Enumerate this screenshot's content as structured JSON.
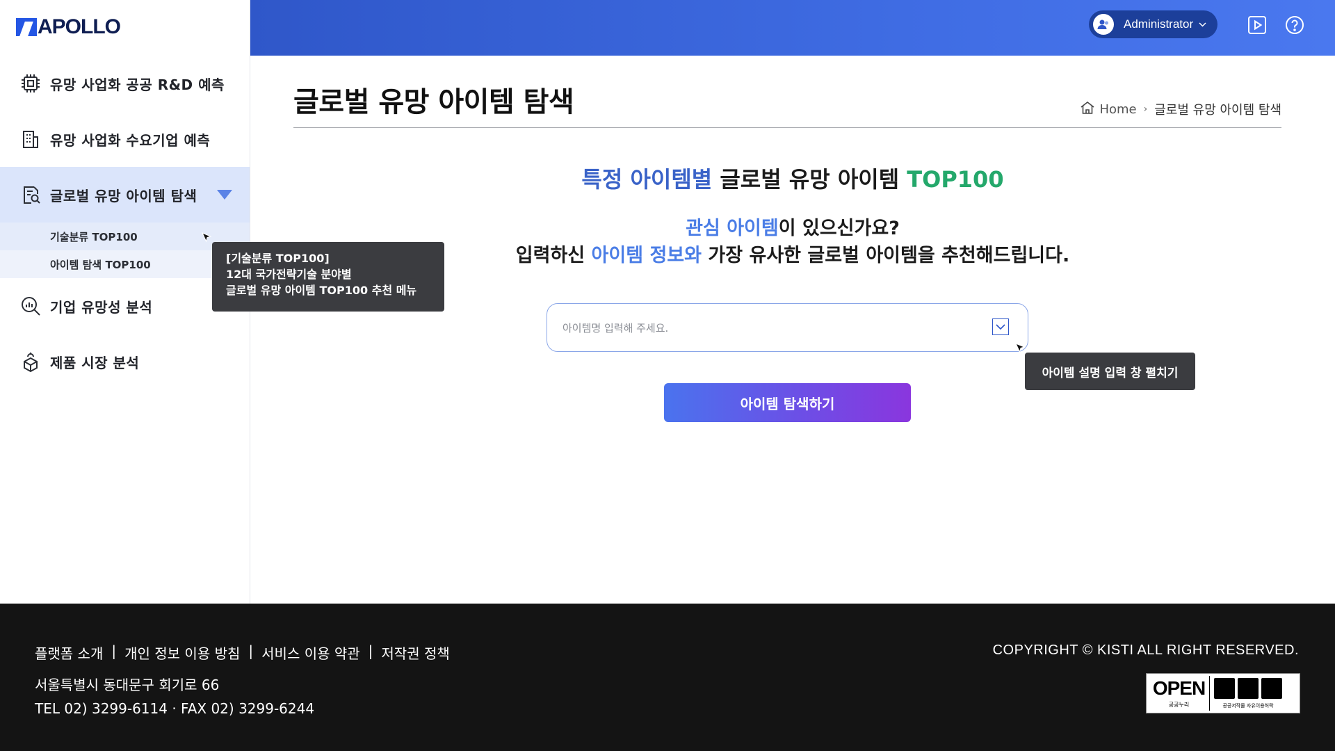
{
  "logo": {
    "text": "APOLLO"
  },
  "sidebar": {
    "items": [
      {
        "label": "유망 사업화 공공 R&D 예측",
        "icon": "chip-icon"
      },
      {
        "label": "유망 사업화 수요기업 예측",
        "icon": "building-icon"
      },
      {
        "label": "글로벌 유망 아이템 탐색",
        "icon": "search-document-icon",
        "active": true,
        "subitems": [
          {
            "label": "기술분류 TOP100"
          },
          {
            "label": "아이템 탐색 TOP100"
          }
        ]
      },
      {
        "label": "기업 유망성 분석",
        "icon": "analytics-search-icon"
      },
      {
        "label": "제품 시장 분석",
        "icon": "product-cube-icon"
      }
    ]
  },
  "header": {
    "user": "Administrator",
    "icons": [
      "play-icon",
      "help-icon"
    ]
  },
  "page": {
    "title": "글로벌 유망 아이템 탐색",
    "breadcrumb": {
      "home": "Home",
      "current": "글로벌 유망 아이템 탐색"
    },
    "headline": {
      "part1": "특정 아이템별",
      "part2": " 글로벌 유망 아이템 ",
      "part3": "TOP100"
    },
    "question": {
      "part1": "관심 아이템",
      "part2": "이 있으신가요?"
    },
    "subline": {
      "part1": "입력하신 ",
      "part2": "아이템 정보와",
      "part3": " 가장 유사한 글로벌 아이템을 추천해드립니다."
    },
    "search": {
      "placeholder": "아이템명 입력해 주세요.",
      "value": ""
    },
    "button": "아이템 탐색하기"
  },
  "tooltips": {
    "menu": {
      "line1": "[기술분류 TOP100]",
      "line2": "12대 국가전략기술 분야별",
      "line3": "글로벌 유망 아이템 TOP100 추천 메뉴"
    },
    "expand": "아이템 설명 입력 창 펼치기"
  },
  "footer": {
    "links": [
      "플랫폼 소개",
      "개인 정보 이용 방침",
      "서비스 이용 약관",
      "저작권 정책"
    ],
    "address": "서울특별시 동대문구 회기로 66",
    "contact": "TEL 02) 3299-6114 · FAX 02) 3299-6244",
    "copyright": "COPYRIGHT © KISTI ALL RIGHT RESERVED.",
    "license": {
      "logo": "OPEN",
      "caption": "공공누리",
      "caption2": "공공저작물 자유이용허락"
    }
  },
  "colors": {
    "accent": "#2f57c9",
    "green": "#24a86b",
    "footer_bg": "#141414"
  }
}
